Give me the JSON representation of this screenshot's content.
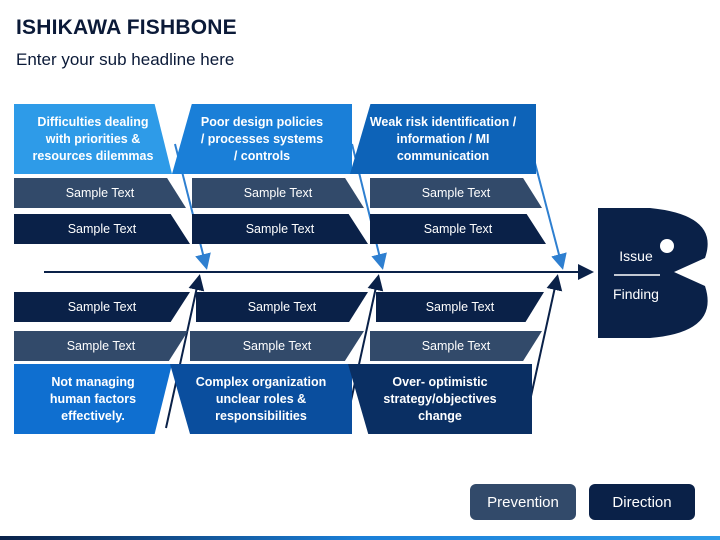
{
  "header": {
    "title": "ISHIKAWA FISHBONE",
    "subtitle": "Enter your sub headline here"
  },
  "top_causes": [
    {
      "label": "Difficulties dealing with priorities & resources dilemmas",
      "items": [
        "Sample Text",
        "Sample Text"
      ]
    },
    {
      "label": "Poor design policies / processes systems / controls",
      "items": [
        "Sample Text",
        "Sample Text"
      ]
    },
    {
      "label": "Weak risk identification / information / MI communication",
      "items": [
        "Sample Text",
        "Sample Text"
      ]
    }
  ],
  "bottom_causes": [
    {
      "label": "Not managing human factors effectively.",
      "items": [
        "Sample Text",
        "Sample Text"
      ]
    },
    {
      "label": "Complex organization unclear roles & responsibilities",
      "items": [
        "Sample Text",
        "Sample Text"
      ]
    },
    {
      "label": "Over- optimistic strategy/objectives change",
      "items": [
        "Sample Text",
        "Sample Text"
      ]
    }
  ],
  "fish_head": {
    "line1": "Issue",
    "line2": "Finding"
  },
  "buttons": {
    "prevention": "Prevention",
    "direction": "Direction"
  },
  "colors": {
    "dark_navy": "#0a2148",
    "slate": "#324a6a",
    "accent_blue": "#1a7fd8",
    "light_blue": "#2e9be8"
  }
}
